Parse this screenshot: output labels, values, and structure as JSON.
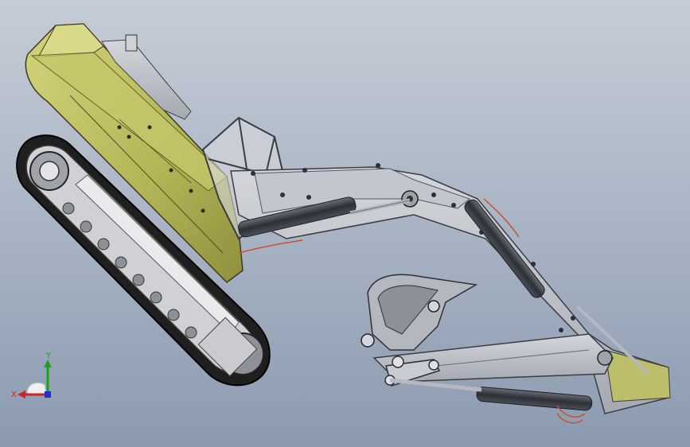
{
  "view": {
    "background_top": "#c5ccd6",
    "background_bottom": "#8c9ab0"
  },
  "model": {
    "subject": "excavator",
    "colors": {
      "cab_body": "#b7b85e",
      "cab_shade": "#8f8f3e",
      "steel": "#b9bcc2",
      "steel_dark": "#80848c",
      "track": "#2a2a2a",
      "cylinder": "#3a3d44",
      "hose": "#c8512e"
    }
  },
  "triad": {
    "x_label": "X",
    "y_label": "Y",
    "x_color": "#d32020",
    "y_color": "#1aa31a",
    "z_color": "#2030c8"
  }
}
